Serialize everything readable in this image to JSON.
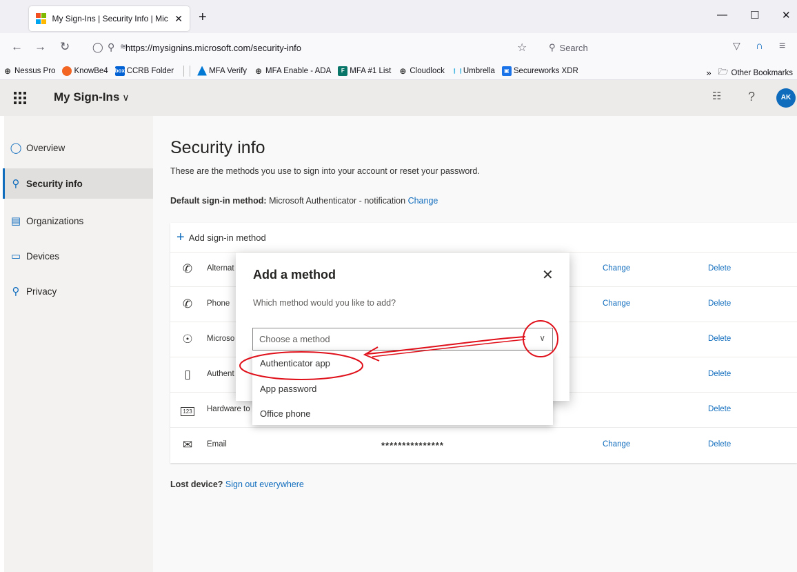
{
  "browser": {
    "tab_title": "My Sign-Ins | Security Info | Mic",
    "tab_close": "✕",
    "new_tab": "+",
    "url": "https://mysignins.microsoft.com/security-info",
    "search_placeholder": "Search",
    "bookmarks": [
      {
        "label": "Nessus Pro",
        "icon": "globe-icon"
      },
      {
        "label": "KnowBe4",
        "icon": "knowbe4-icon"
      },
      {
        "label": "CCRB Folder",
        "icon": "box-icon"
      },
      {
        "label": "MFA Verify",
        "icon": "azure-icon"
      },
      {
        "label": "MFA Enable - ADA",
        "icon": "globe-icon"
      },
      {
        "label": "MFA #1 List",
        "icon": "forms-icon"
      },
      {
        "label": "Cloudlock",
        "icon": "globe-icon"
      },
      {
        "label": "Umbrella",
        "icon": "cisco-icon"
      },
      {
        "label": "Secureworks XDR",
        "icon": "secureworks-icon"
      }
    ],
    "other_bookmarks": "Other Bookmarks",
    "overflow": "»"
  },
  "app": {
    "title": "My Sign-Ins",
    "avatar_initials": "AK"
  },
  "sidebar": {
    "items": [
      {
        "label": "Overview",
        "icon": "person-icon"
      },
      {
        "label": "Security info",
        "icon": "person-key-icon"
      },
      {
        "label": "Organizations",
        "icon": "briefcase-icon"
      },
      {
        "label": "Devices",
        "icon": "laptop-icon"
      },
      {
        "label": "Privacy",
        "icon": "lock-icon"
      }
    ]
  },
  "main": {
    "title": "Security info",
    "subtitle": "These are the methods you use to sign into your account or reset your password.",
    "default_label": "Default sign-in method:",
    "default_value": "Microsoft Authenticator - notification",
    "default_change": "Change",
    "add_method": "Add sign-in method",
    "methods": [
      {
        "name": "Alternat",
        "detail": "",
        "change": "Change",
        "delete": "Delete",
        "icon": "phone-icon"
      },
      {
        "name": "Phone",
        "detail": "",
        "change": "Change",
        "delete": "Delete",
        "icon": "phone-icon"
      },
      {
        "name": "Microso",
        "detail": "",
        "change": "",
        "delete": "Delete",
        "icon": "authenticator-icon"
      },
      {
        "name": "Authent",
        "detail": "",
        "change": "",
        "delete": "Delete",
        "icon": "mobile-icon"
      },
      {
        "name": "Hardware to",
        "detail": "",
        "change": "",
        "delete": "Delete",
        "icon": "hardware-token-icon"
      },
      {
        "name": "Email",
        "detail": "***************",
        "change": "Change",
        "delete": "Delete",
        "icon": "mail-icon"
      }
    ],
    "lost_label": "Lost device?",
    "lost_link": "Sign out everywhere"
  },
  "modal": {
    "title": "Add a method",
    "question": "Which method would you like to add?",
    "dropdown_placeholder": "Choose a method",
    "options": [
      "Authenticator app",
      "App password",
      "Office phone"
    ]
  },
  "colors": {
    "accent": "#0f6cbd",
    "annotation": "#e0101a"
  }
}
